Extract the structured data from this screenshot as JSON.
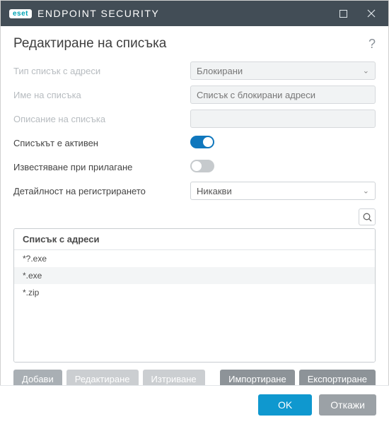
{
  "titlebar": {
    "brand_badge": "eset",
    "title": "ENDPOINT SECURITY"
  },
  "header": {
    "page_title": "Редактиране на списъка"
  },
  "form": {
    "type_label": "Тип списък с адреси",
    "type_value": "Блокирани",
    "name_label": "Име на списъка",
    "name_value": "Списък с блокирани адреси",
    "desc_label": "Описание на списъка",
    "desc_value": "",
    "active_label": "Списъкът е активен",
    "notify_label": "Известяване при прилагане",
    "verbosity_label": "Детайлност на регистрирането",
    "verbosity_value": "Никакви"
  },
  "list": {
    "header": "Списък с адреси",
    "items": [
      "*?.exe",
      "*.exe",
      "*.zip"
    ]
  },
  "toolbar": {
    "add": "Добави",
    "edit": "Редактиране",
    "delete": "Изтриване",
    "import": "Импортиране",
    "export": "Експортиране"
  },
  "footer": {
    "ok": "OK",
    "cancel": "Откажи"
  }
}
